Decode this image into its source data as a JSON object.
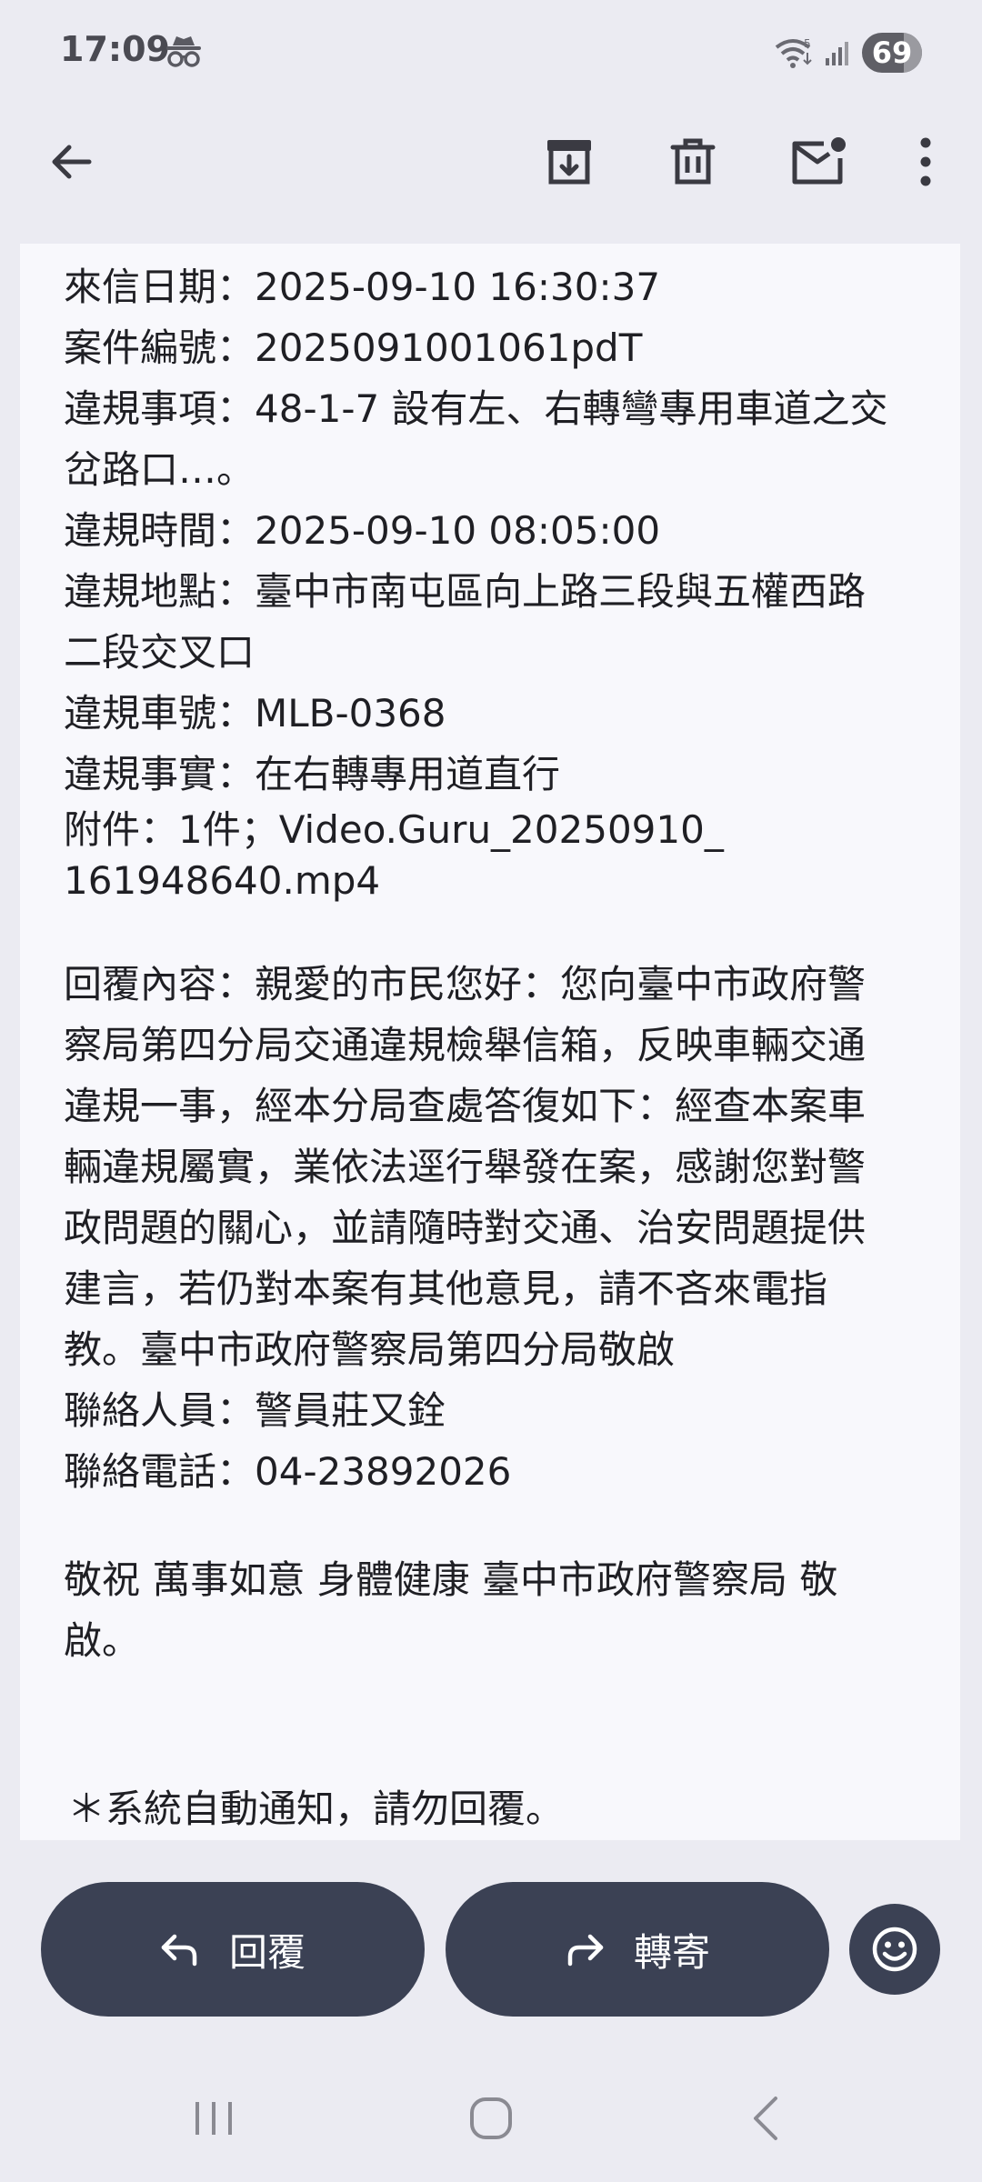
{
  "status_bar": {
    "time": "17:09",
    "incognito_icon": "incognito-icon",
    "wifi_icon": "wifi-icon",
    "signal_icon": "signal-icon",
    "battery": "69",
    "battery_level_percent": 69
  },
  "toolbar": {
    "back_icon": "arrow-left-icon",
    "archive_icon": "archive-icon",
    "delete_icon": "trash-icon",
    "mark_unread_icon": "mail-unread-icon",
    "more_icon": "more-vertical-icon"
  },
  "mail": {
    "lines": {
      "date": "來信日期：2025-09-10 16:30:37",
      "case_no": "案件編號：2025091001061pdT",
      "violation_item_1": "違規事項：48-1-7 設有左、右轉彎專用車道之交",
      "violation_item_2": "岔路口…。",
      "violation_time": "違規時間：2025-09-10 08:05:00",
      "violation_place_1": "違規地點：臺中市南屯區向上路三段與五權西路",
      "violation_place_2": "二段交叉口",
      "plate": "違規車號：MLB-0368",
      "violation_fact": "違規事實：在右轉專用道直行",
      "attachment_1": "附件：1件；Video.Guru_20250910_",
      "attachment_2": "161948640.mp4",
      "reply_1": "回覆內容：親愛的市民您好：您向臺中市政府警",
      "reply_2": "察局第四分局交通違規檢舉信箱，反映車輛交通",
      "reply_3": "違規一事，經本分局查處答復如下：經查本案車",
      "reply_4": "輛違規屬實，業依法逕行舉發在案，感謝您對警",
      "reply_5": "政問題的關心，並請隨時對交通、治安問題提供",
      "reply_6": "建言，若仍對本案有其他意見，請不吝來電指",
      "reply_7": "教。臺中市政府警察局第四分局敬啟",
      "contact_person": "聯絡人員：警員莊又銓",
      "contact_phone": "聯絡電話：04-23892026",
      "closing_1": "敬祝 萬事如意 身體健康 臺中市政府警察局 敬",
      "closing_2": "啟。",
      "auto_notice": "＊系統自動通知，請勿回覆。"
    }
  },
  "actions": {
    "reply_label": "回覆",
    "reply_icon": "reply-icon",
    "forward_label": "轉寄",
    "forward_icon": "forward-icon",
    "emoji_icon": "emoji-icon"
  },
  "nav_bar": {
    "recents_icon": "recents-icon",
    "home_icon": "home-icon",
    "back_icon": "nav-back-icon"
  }
}
